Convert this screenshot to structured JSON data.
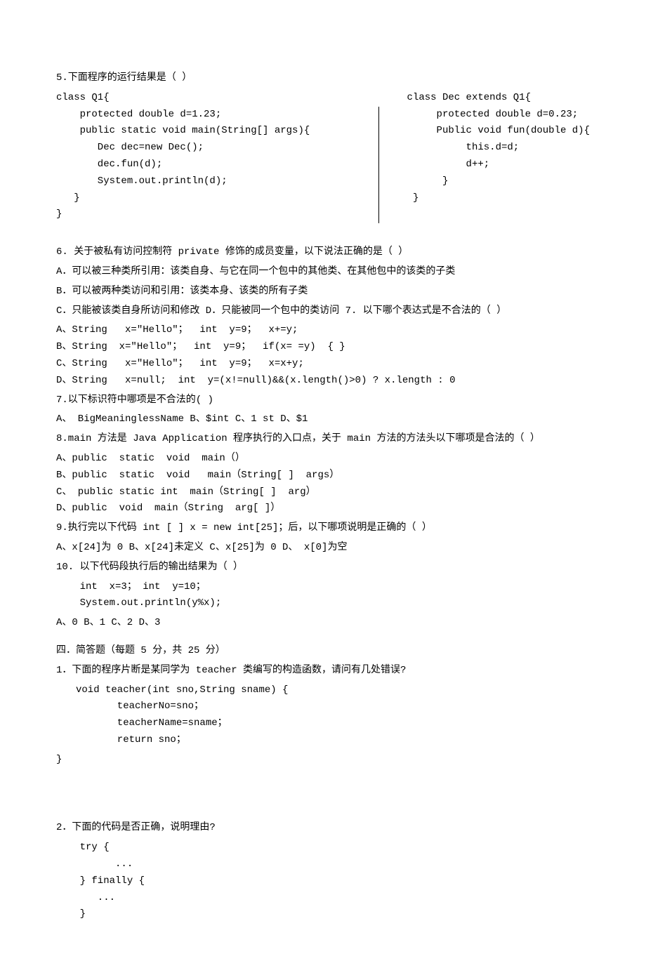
{
  "q5": {
    "title": "5.下面程序的运行结果是（    ）",
    "left": "class Q1{\n    protected double d=1.23;\n    public static void main(String[] args){\n       Dec dec=new Dec();\n       dec.fun(d);\n       System.out.println(d);\n   }\n}",
    "right": "class Dec extends Q1{\n     protected double d=0.23;\n     Public void fun(double d){\n          this.d=d;\n          d++;\n      }\n }"
  },
  "q6": {
    "title": "6. 关于被私有访问控制符 private 修饰的成员变量，以下说法正确的是（   ）",
    "a": "A．可以被三种类所引用：该类自身、与它在同一个包中的其他类、在其他包中的该类的子类",
    "b": "B．可以被两种类访问和引用：该类本身、该类的所有子类",
    "cd": "C．只能被该类自身所访问和修改    D．只能被同一个包中的类访问 7. 以下哪个表达式是不合法的（      ）",
    "opts": "A、String   x=\"Hello\"；  int  y=9；  x+=y;\nB、String  x=\"Hello\"；  int  y=9；  if(x= =y)  { }\nC、String   x=\"Hello\"；  int  y=9；  x=x+y;\nD、String   x=null;  int  y=(x!=null)&&(x.length()>0) ? x.length : 0"
  },
  "q7": {
    "title": "7.以下标识符中哪项是不合法的(     )",
    "opts": "A、 BigMeaninglessName    B、$int    C、1 st    D、$1"
  },
  "q8": {
    "title": "8.main 方法是 Java Application 程序执行的入口点，关于 main 方法的方法头以下哪项是合法的（     ）",
    "opts": "A、public  static  void  main（）\nB、public  static  void   main（String[ ]  args）\nC、 public static int  main（String[ ]  arg）\nD、public  void  main（String  arg[ ]）"
  },
  "q9": {
    "title": "9.执行完以下代码 int [ ]  x = new   int[25]；后，以下哪项说明是正确的（      ）",
    "opts": "A、x[24]为 0     B、x[24]未定义     C、x[25]为 0    D、   x[0]为空"
  },
  "q10": {
    "title": "10. 以下代码段执行后的输出结果为（         ）",
    "code": "    int  x=3； int  y=10；\n    System.out.println(y%x);",
    "opts": "  A、0     B、1        C、2        D、3"
  },
  "section4": {
    "title": "四．简答题（每题 5 分，共 25 分）",
    "q1": {
      "title": "1．下面的程序片断是某同学为 teacher 类编写的构造函数，请问有几处错误?",
      "code": "void teacher(int sno,String sname) {\n       teacherNo=sno；\n       teacherName=sname；\n       return sno；"
    },
    "closebrace": "}",
    "q2": {
      "title": "2．下面的代码是否正确，说明理由?",
      "code": "    try {\n          ...\n    } finally {\n       ...\n    }"
    }
  }
}
